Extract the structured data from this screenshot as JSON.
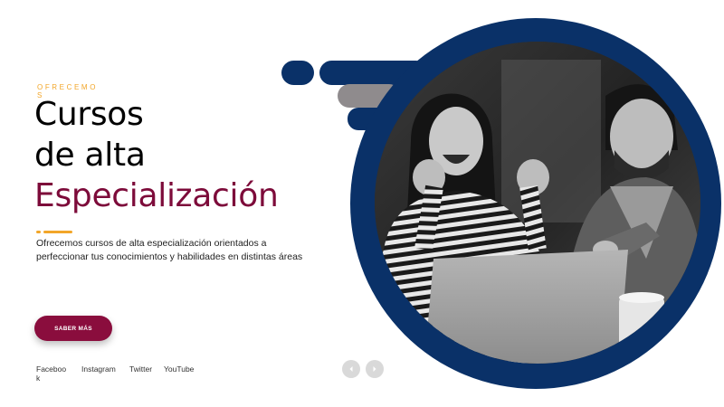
{
  "hero": {
    "eyebrow": "OFRECEMOS",
    "title_line1": "Cursos",
    "title_line2": "de alta",
    "title_accent": "Especialización",
    "description": "Ofrecemos cursos de alta especialización orientados a perfeccionar tus conocimientos y habilidades en distintas áreas",
    "cta_label": "SABER MÁS"
  },
  "social": [
    "Facebook",
    "Instagram",
    "Twitter",
    "YouTube"
  ],
  "colors": {
    "brand_navy": "#0a3168",
    "accent_maroon": "#7d0b3a",
    "accent_orange": "#f2a629",
    "pill_gray": "#8f8b8d"
  },
  "icons": [
    "chevron-left-icon",
    "chevron-right-icon"
  ]
}
